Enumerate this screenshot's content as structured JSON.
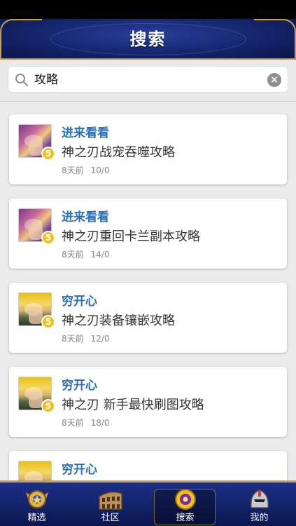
{
  "header": {
    "title": "搜索"
  },
  "search": {
    "query": "攻略",
    "search_icon": "search-icon",
    "clear_icon": "clear-icon"
  },
  "results": [
    {
      "author": "进来看看",
      "title": "神之刃战宠吞噬攻略",
      "time": "8天前",
      "stats": "10/0",
      "level": "5",
      "avatar": "game"
    },
    {
      "author": "进来看看",
      "title": "神之刃重回卡兰副本攻略",
      "time": "8天前",
      "stats": "14/0",
      "level": "5",
      "avatar": "game"
    },
    {
      "author": "穷开心",
      "title": "神之刃装备镶嵌攻略",
      "time": "8天前",
      "stats": "12/0",
      "level": "5",
      "avatar": "anime"
    },
    {
      "author": "穷开心",
      "title": "神之刃 新手最快刷图攻略",
      "time": "8天前",
      "stats": "18/0",
      "level": "5",
      "avatar": "anime"
    },
    {
      "author": "穷开心",
      "title": "",
      "time": "",
      "stats": "",
      "level": "",
      "avatar": "anime"
    }
  ],
  "tabs": [
    {
      "label": "精选",
      "icon": "medal-icon"
    },
    {
      "label": "社区",
      "icon": "colosseum-icon"
    },
    {
      "label": "搜索",
      "icon": "search-eye-icon"
    },
    {
      "label": "我的",
      "icon": "helmet-icon"
    }
  ],
  "colors": {
    "accent_blue": "#2a6fb8",
    "nav_dark": "#15256e",
    "gold": "#c9a14a",
    "badge": "#f2c01a"
  }
}
